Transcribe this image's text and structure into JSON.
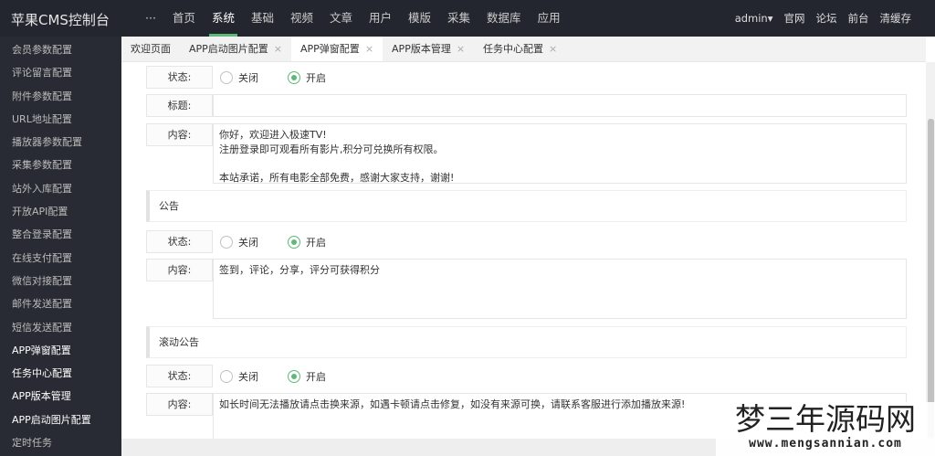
{
  "header": {
    "title": "苹果CMS控制台",
    "more": "···",
    "nav": [
      "首页",
      "系统",
      "基础",
      "视频",
      "文章",
      "用户",
      "模版",
      "采集",
      "数据库",
      "应用"
    ],
    "active_nav": 1,
    "user": "admin▾",
    "links": [
      "官网",
      "论坛",
      "前台",
      "清缓存"
    ]
  },
  "sidebar": {
    "items": [
      "会员参数配置",
      "评论留言配置",
      "附件参数配置",
      "URL地址配置",
      "播放器参数配置",
      "采集参数配置",
      "站外入库配置",
      "开放API配置",
      "整合登录配置",
      "在线支付配置",
      "微信对接配置",
      "邮件发送配置",
      "短信发送配置",
      "APP弹窗配置",
      "任务中心配置",
      "APP版本管理",
      "APP启动图片配置",
      "定时任务"
    ]
  },
  "tabs": [
    {
      "label": "欢迎页面"
    },
    {
      "label": "APP启动图片配置",
      "close": "×"
    },
    {
      "label": "APP弹窗配置",
      "close": "×",
      "active": true
    },
    {
      "label": "APP版本管理",
      "close": "×"
    },
    {
      "label": "任务中心配置",
      "close": "×"
    }
  ],
  "form": {
    "status_label": "状态:",
    "title_label": "标题:",
    "content_label": "内容:",
    "off": "关闭",
    "on": "开启",
    "popup": {
      "status": "开启",
      "title": "",
      "content": "你好，欢迎进入极速TV!\n注册登录即可观看所有影片,积分可兑换所有权限。\n\n本站承诺，所有电影全部免费，感谢大家支持，谢谢!"
    },
    "notice": {
      "heading": "公告",
      "status": "开启",
      "content": "签到，评论，分享，评分可获得积分"
    },
    "marquee": {
      "heading": "滚动公告",
      "status": "开启",
      "content": "如长时间无法播放请点击换来源，如遇卡顿请点击修复，如没有来源可换，请联系客服进行添加播放来源!"
    }
  },
  "watermark": {
    "title": "梦三年源码网",
    "url": "www.mengsannian.com"
  },
  "colors": {
    "topbar": "#23262e",
    "sidebar": "#282b33",
    "accent": "#5fb878"
  }
}
